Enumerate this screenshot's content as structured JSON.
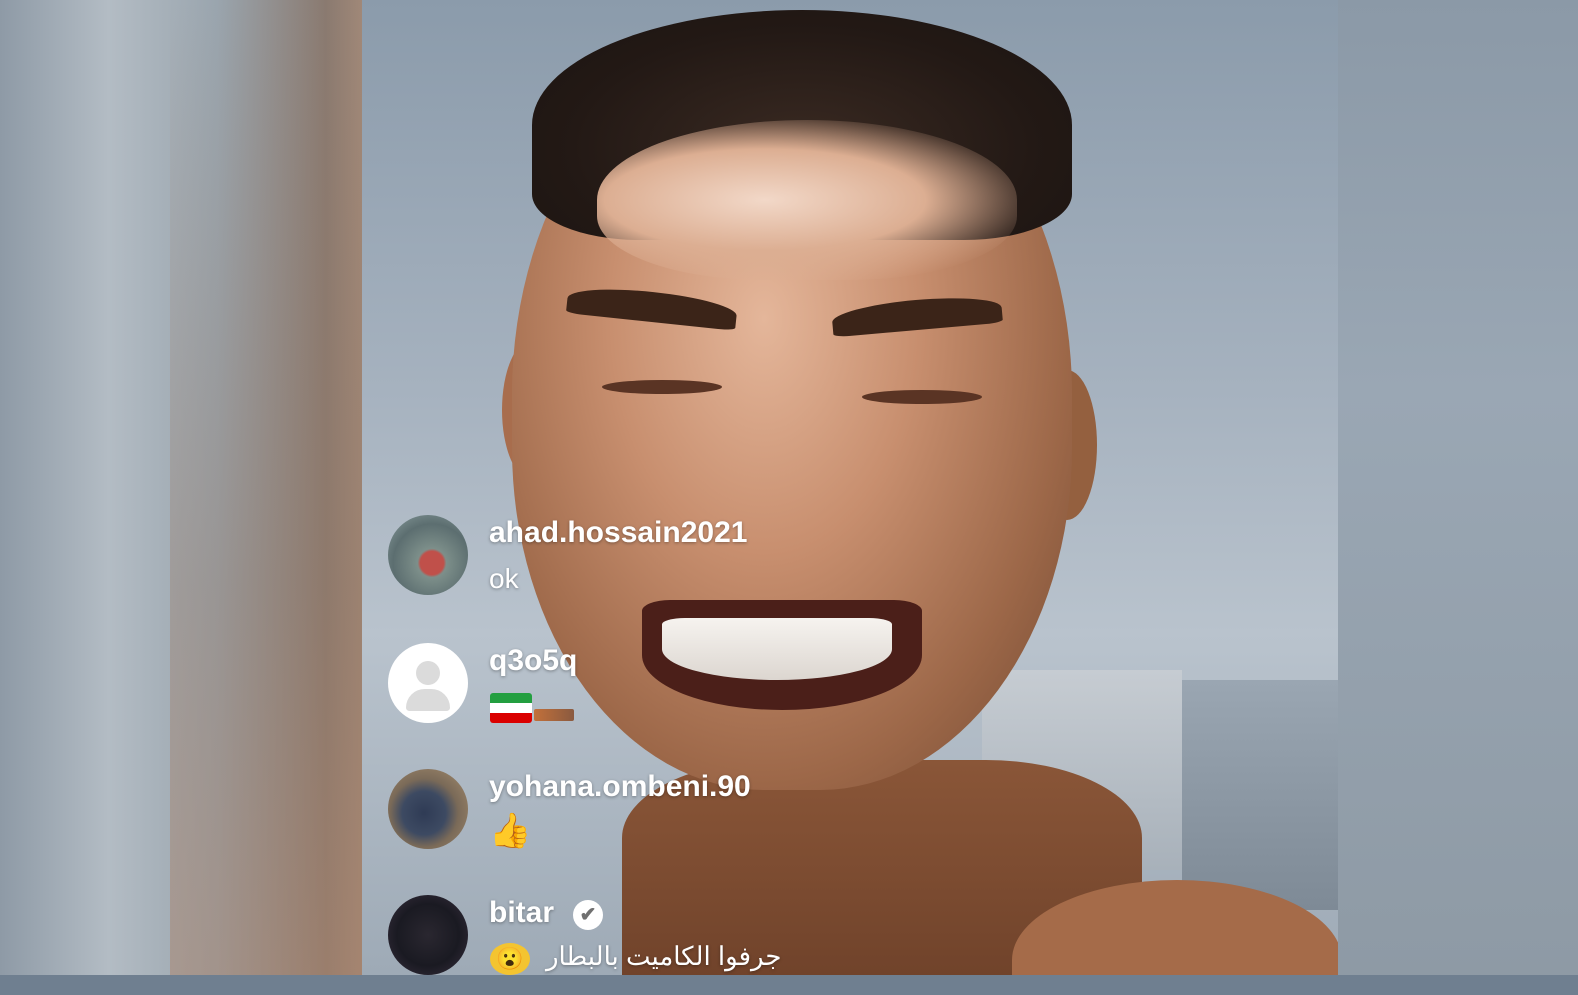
{
  "live": {
    "comments": [
      {
        "username": "ahad.hossain2021",
        "message": "ok",
        "avatar": "photo-avatar"
      },
      {
        "username": "q3o5q",
        "message": "",
        "flag": "iran-flag",
        "avatar": "default-avatar"
      },
      {
        "username": "yohana.ombeni.90",
        "message": "👍",
        "avatar": "photo-avatar"
      },
      {
        "username": "bitar",
        "verified": true,
        "message": "جرفوا الكاميت بالبطار",
        "sticker": "emoji-sticker-icon",
        "avatar": "photo-avatar"
      }
    ]
  },
  "icons": {
    "verified": "✔",
    "sticker": "😮"
  },
  "colors": {
    "username_text": "#ffffff",
    "message_text": "#ffffff",
    "verified_badge_bg": "#ffffff"
  }
}
